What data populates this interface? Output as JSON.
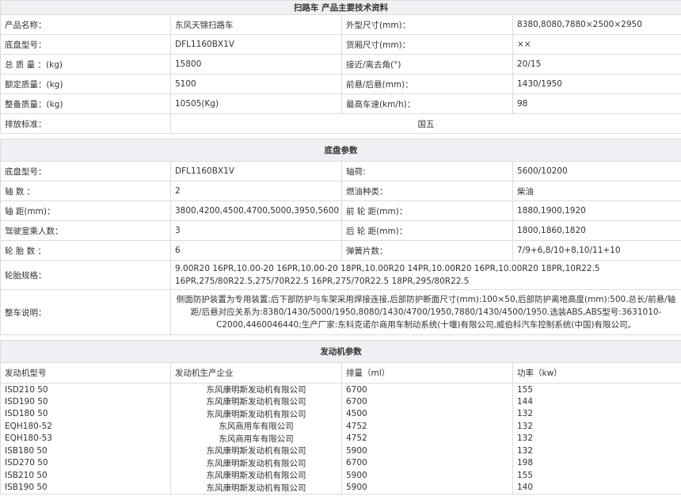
{
  "section1": {
    "title": "扫路车    产品主要技术资料",
    "rows": [
      [
        "产品名称：",
        "东风天锦扫路车",
        "外型尺寸(mm)：",
        "8380,8080,7880×2500×2950"
      ],
      [
        "底盘型号：",
        "DFL1160BX1V",
        "货厢尺寸(mm)：",
        "××"
      ],
      [
        "总 质 量 ：(kg)",
        "15800",
        "接近/离去角(°)",
        "20/15"
      ],
      [
        "额定质量：(kg)",
        "5100",
        "前悬/后悬(mm)：",
        "1430/1950"
      ],
      [
        "整备质量：(kg)",
        "10505(Kg)",
        "最高车速(km/h)：",
        "98"
      ]
    ],
    "emission_label": "排放标准：",
    "emission_value": "国五"
  },
  "section2": {
    "title": "底盘参数",
    "rows": [
      [
        "底盘型号：",
        "DFL1160BX1V",
        "轴荷:",
        "5600/10200"
      ],
      [
        "轴 数 ：",
        "2",
        "燃油种类：",
        "柴油"
      ],
      [
        "轴 距(mm)：",
        "3800,4200,4500,4700,5000,3950,5600",
        "前 轮 距(mm)：",
        "1880,1900,1920"
      ],
      [
        "驾驶室乘人数：",
        "3",
        "后 轮 距(mm)：",
        "1800,1860,1820"
      ],
      [
        "轮 胎 数 ：",
        "6",
        "弹簧片数：",
        "7/9+6,8/10+8,10/11+10"
      ]
    ],
    "tire_label": "轮胎规格：",
    "tire_value": "9.00R20 16PR,10.00-20 16PR,10.00-20 18PR,10.00R20 14PR,10.00R20 16PR,10.00R20 18PR,10R22.5 16PR,275/80R22.5,275/70R22.5 16PR,275/70R22.5 18PR,295/80R22.5",
    "desc_label": "整车说明：",
    "desc_value": "侧面防护装置为专用装置;后下部防护与车架采用焊接连接,后部防护断面尺寸(mm):100×50,后部防护离地高度(mm):500.总长/前悬/轴距/后悬对应关系为:8380/1430/5000/1950,8080/1430/4700/1950,7880/1430/4500/1950.选装ABS,ABS型号:3631010-C2000,4460046440;生产厂家:东科克诺尔商用车制动系统(十堰)有限公司,威伯科汽车控制系统(中国)有限公司。"
  },
  "section3": {
    "title": "发动机参数",
    "headers": [
      "发动机型号",
      "发动机生产企业",
      "排量（ml）",
      "功率（kw）"
    ],
    "rows": [
      [
        "ISD210 50",
        "东风康明斯发动机有限公司",
        "6700",
        "155"
      ],
      [
        "ISD190 50",
        "东风康明斯发动机有限公司",
        "6700",
        "144"
      ],
      [
        "ISD180 50",
        "东风康明斯发动机有限公司",
        "4500",
        "132"
      ],
      [
        "EQH180-52",
        "东风商用车有限公司",
        "4752",
        "132"
      ],
      [
        "EQH180-53",
        "东风商用车有限公司",
        "4752",
        "132"
      ],
      [
        "ISB180 50",
        "东风康明斯发动机有限公司",
        "5900",
        "132"
      ],
      [
        "ISD270 50",
        "东风康明斯发动机有限公司",
        "6700",
        "198"
      ],
      [
        "ISB210 50",
        "东风康明斯发动机有限公司",
        "5900",
        "155"
      ],
      [
        "ISB190 50",
        "东风康明斯发动机有限公司",
        "5900",
        "140"
      ]
    ]
  }
}
